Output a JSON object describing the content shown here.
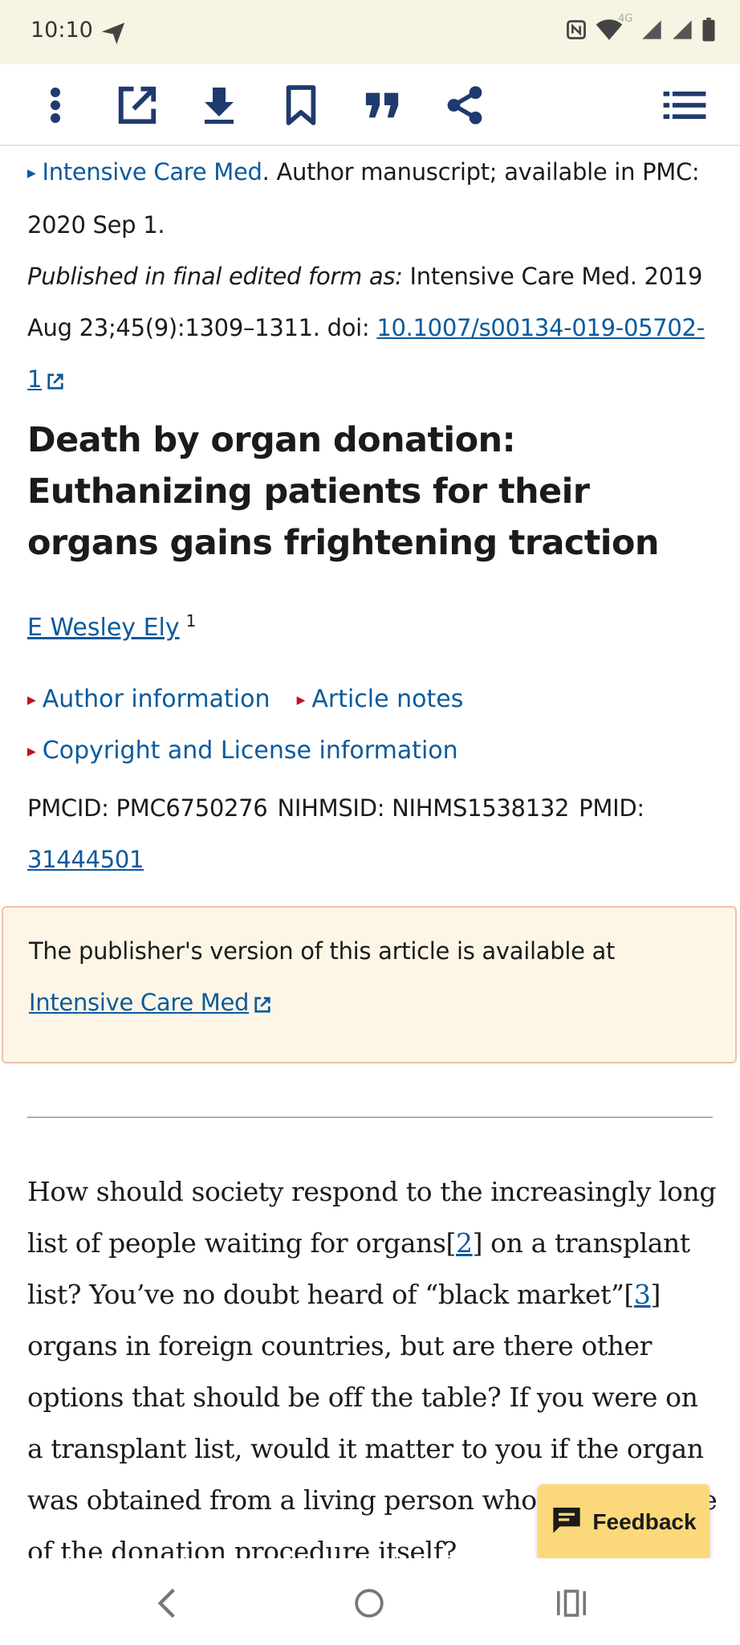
{
  "status": {
    "time": "10:10",
    "network": "4G",
    "icons": [
      "send-icon",
      "nfc-icon",
      "wifi-icon",
      "signal-icon",
      "signal-icon",
      "battery-icon"
    ]
  },
  "toolbar": {
    "icons": [
      "more-vert-icon",
      "open-external-icon",
      "download-icon",
      "bookmark-icon",
      "quote-icon",
      "share-icon",
      "list-icon"
    ]
  },
  "citation": {
    "journal_link": "Intensive Care Med",
    "manuscript_text": ". Author manuscript; available in PMC: 2020 Sep 1.",
    "published_label": "Published in final edited form as:",
    "published_text": " Intensive Care Med. 2019 Aug 23;45(9):1309–1311. doi: ",
    "doi": "10.1007/s00134-019-05702-1"
  },
  "article": {
    "title": "Death by organ donation: Euthanizing patients for their organs gains frightening traction",
    "author": "E Wesley Ely",
    "author_sup": "1",
    "author_info": "Author information",
    "article_notes": "Article notes",
    "copyright": "Copyright and License information",
    "pmcid_text": "PMCID: PMC6750276",
    "nihmsid_text": "NIHMSID: NIHMS1538132",
    "pmid_label": "PMID:",
    "pmid": "31444501"
  },
  "notice": {
    "text": "The publisher's version of this article is available at ",
    "link": "Intensive Care Med"
  },
  "body": {
    "p1_a": "How should society respond to the increasingly long list of people waiting for organs[",
    "ref2": "2",
    "p1_b": "] on a transplant list? You’ve no doubt heard of “black market”[",
    "ref3": "3",
    "p1_c": "] organs in foreign countries, but are there other options that should be off the table? If you were on a transplant list, would it matter to you if the organ was obtained from a living person who died because of the donation procedure itself?"
  },
  "feedback": {
    "label": "Feedback"
  },
  "navbar": {
    "icons": [
      "back-icon",
      "home-icon",
      "recents-icon"
    ]
  },
  "colors": {
    "link": "#0b5a9c",
    "status_bg": "#f7f4e4",
    "notice_bg": "#fdf6e6",
    "notice_border": "#f0c0a8",
    "feedback_bg": "#fbd97a",
    "triangle_red": "#c1121f"
  }
}
